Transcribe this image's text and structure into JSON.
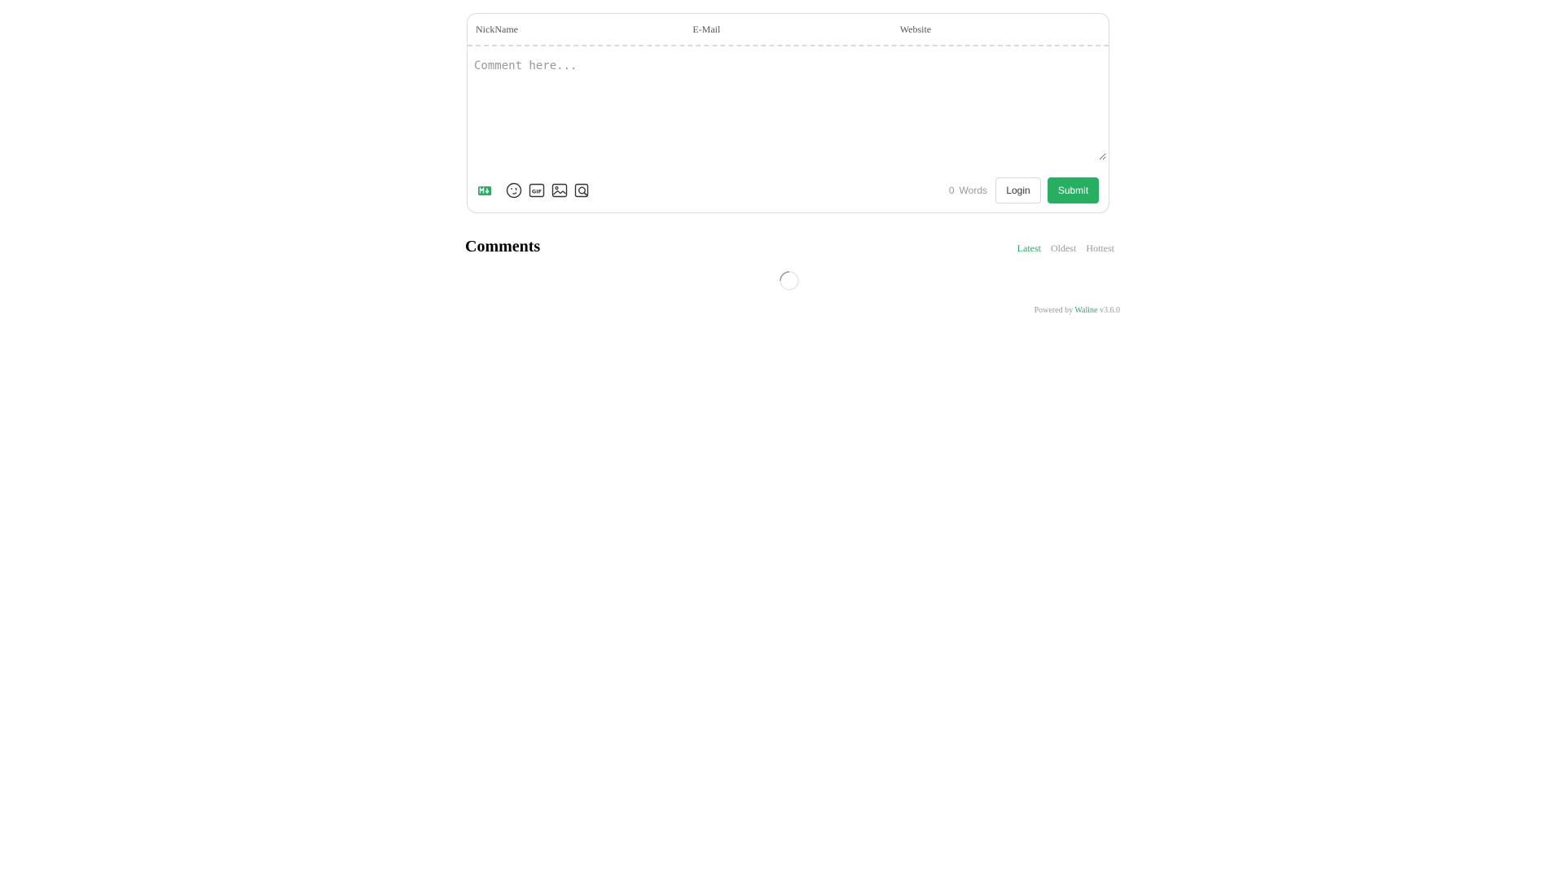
{
  "header": {
    "nick_label": "NickName",
    "mail_label": "E-Mail",
    "link_label": "Website"
  },
  "editor": {
    "placeholder": "Comment here..."
  },
  "toolbar": {
    "icons": [
      "markdown-icon",
      "emoji-icon",
      "gif-icon",
      "image-icon",
      "preview-icon"
    ],
    "word_count": "0",
    "word_unit": "Words",
    "login_label": "Login",
    "submit_label": "Submit"
  },
  "comments": {
    "title": "Comments",
    "sort": [
      "Latest",
      "Oldest",
      "Hottest"
    ],
    "active_sort": "Latest"
  },
  "footer": {
    "powered_prefix": "Powered by",
    "brand": "Waline",
    "version": "v3.6.0"
  },
  "colors": {
    "accent": "#27ae60",
    "muted": "#999999",
    "border": "#dcdcdc"
  }
}
